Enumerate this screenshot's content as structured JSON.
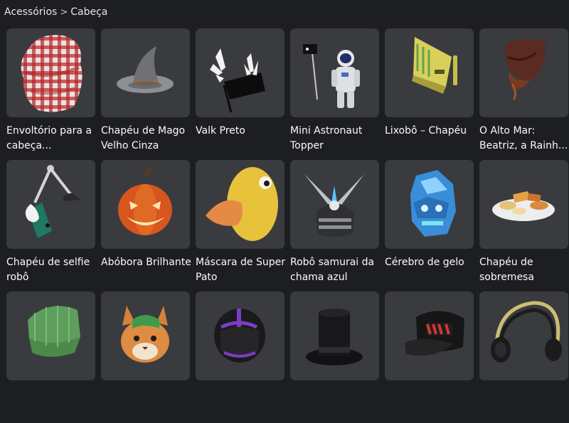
{
  "breadcrumb": {
    "root": "Acessórios",
    "separator": ">",
    "current": "Cabeça"
  },
  "items": [
    {
      "name": "Envoltório para a cabeça...",
      "icon": "plaid-head-wrap-icon"
    },
    {
      "name": "Chapéu de Mago Velho Cinza",
      "icon": "wizard-hat-icon"
    },
    {
      "name": "Valk Preto",
      "icon": "valkyrie-helm-icon"
    },
    {
      "name": "Mini Astronaut Topper",
      "icon": "astronaut-topper-icon"
    },
    {
      "name": "Lixobô – Chapéu",
      "icon": "robot-hat-icon"
    },
    {
      "name": "O Alto Mar: Beatriz, a Rainh...",
      "icon": "pirate-hat-icon"
    },
    {
      "name": "Chapéu de selfie robô",
      "icon": "selfie-arm-hat-icon"
    },
    {
      "name": "Abóbora Brilhante",
      "icon": "pumpkin-icon"
    },
    {
      "name": "Máscara de Super Pato",
      "icon": "duck-mask-icon"
    },
    {
      "name": "Robô samurai da chama azul",
      "icon": "samurai-helmet-icon"
    },
    {
      "name": "Cérebro de gelo",
      "icon": "ice-brain-icon"
    },
    {
      "name": "Chapéu de sobremesa",
      "icon": "dessert-plate-hat-icon"
    },
    {
      "name": "",
      "icon": "green-cap-icon"
    },
    {
      "name": "",
      "icon": "cat-with-cap-icon"
    },
    {
      "name": "",
      "icon": "purple-visor-helmet-icon"
    },
    {
      "name": "",
      "icon": "top-hat-icon"
    },
    {
      "name": "",
      "icon": "gtp-snapback-icon"
    },
    {
      "name": "",
      "icon": "headphones-icon"
    }
  ],
  "colors": {
    "page_bg": "#1d1e22",
    "card_bg": "#393b3f",
    "text": "#fbfbfb"
  }
}
